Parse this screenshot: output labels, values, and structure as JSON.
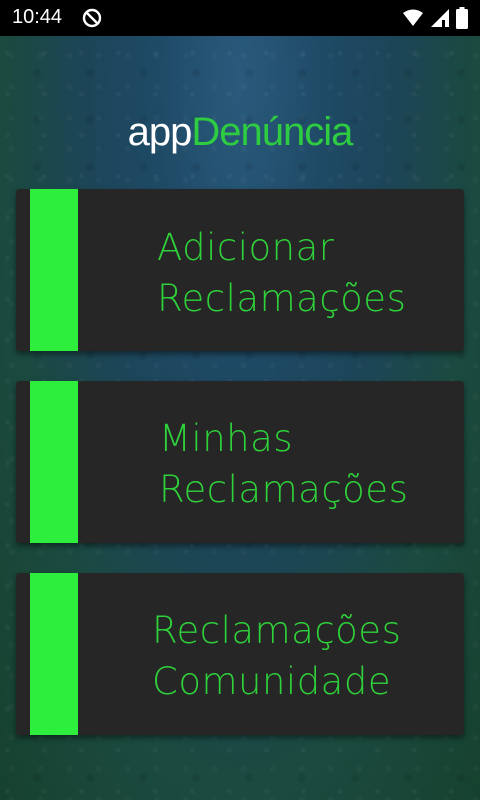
{
  "status_bar": {
    "time": "10:44"
  },
  "header": {
    "title_prefix": "app",
    "title_main": "Denúncia"
  },
  "menu": [
    {
      "line1": "Adicionar",
      "line2": "Reclamações"
    },
    {
      "line1": "Minhas",
      "line2": "Reclamações"
    },
    {
      "line1": "Reclamações",
      "line2": "Comunidade"
    }
  ],
  "colors": {
    "accent": "#2ded3d",
    "label": "#2fd13a",
    "card": "#262626"
  },
  "icons": {
    "status_left": "no-disturb-icon",
    "status_right": [
      "wifi-icon",
      "cell-signal-icon",
      "battery-icon"
    ]
  }
}
